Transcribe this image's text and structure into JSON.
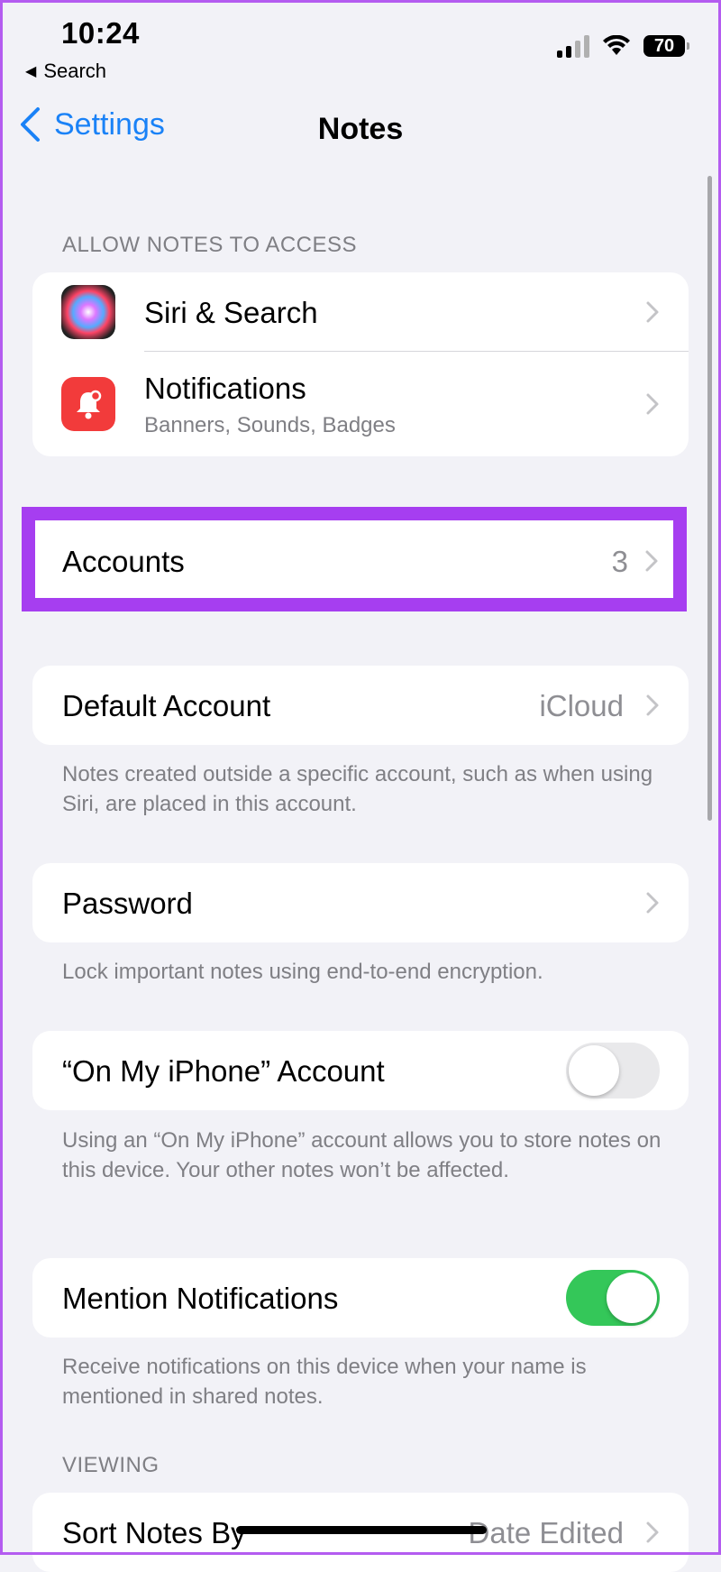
{
  "status_bar": {
    "time": "10:24",
    "back_app": "Search",
    "battery": "70"
  },
  "nav": {
    "back_label": "Settings",
    "title": "Notes"
  },
  "sections": {
    "allow_access": {
      "header": "ALLOW NOTES TO ACCESS",
      "siri": {
        "label": "Siri & Search",
        "icon": "siri-icon"
      },
      "notifications": {
        "label": "Notifications",
        "subtitle": "Banners, Sounds, Badges",
        "icon": "bell-icon"
      }
    },
    "accounts": {
      "label": "Accounts",
      "value": "3",
      "highlight_color": "#a63ef0"
    },
    "default_account": {
      "label": "Default Account",
      "value": "iCloud",
      "footer": "Notes created outside a specific account, such as when using Siri, are placed in this account."
    },
    "password": {
      "label": "Password",
      "footer": "Lock important notes using end-to-end encryption."
    },
    "on_my_iphone": {
      "label": "“On My iPhone” Account",
      "enabled": false,
      "footer": "Using an “On My iPhone” account allows you to store notes on this device. Your other notes won’t be affected."
    },
    "mention": {
      "label": "Mention Notifications",
      "enabled": true,
      "footer": "Receive notifications on this device when your name is mentioned in shared notes."
    },
    "viewing": {
      "header": "VIEWING",
      "sort": {
        "label": "Sort Notes By",
        "value": "Date Edited"
      }
    }
  },
  "colors": {
    "accent": "#1a82f7",
    "toggle_on": "#34c759",
    "background": "#f2f2f7"
  }
}
